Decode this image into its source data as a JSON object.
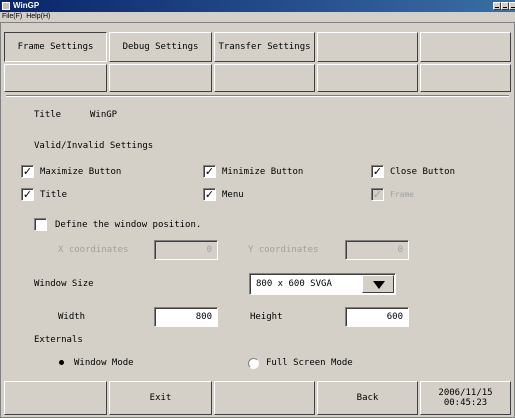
{
  "window": {
    "title": "WinGP"
  },
  "menu": {
    "file": "File(F)",
    "help": "Help(H)"
  },
  "tabs": [
    {
      "label": "Frame Settings",
      "active": true
    },
    {
      "label": "Debug Settings"
    },
    {
      "label": "Transfer Settings"
    },
    {
      "label": ""
    },
    {
      "label": ""
    }
  ],
  "title_row": {
    "label": "Title",
    "value": "WinGP"
  },
  "valid_section": {
    "heading": "Valid/Invalid Settings"
  },
  "checkboxes": {
    "maximize": {
      "label": "Maximize Button",
      "checked": true,
      "mark": "✓"
    },
    "minimize": {
      "label": "Minimize Button",
      "checked": true,
      "mark": "✓"
    },
    "close": {
      "label": "Close Button",
      "checked": true,
      "mark": "✓"
    },
    "title": {
      "label": "Title",
      "checked": true,
      "mark": "✓"
    },
    "menu": {
      "label": "Menu",
      "checked": true,
      "mark": "✓"
    },
    "frame": {
      "label": "Frame",
      "checked": true,
      "disabled": true,
      "mark": "✓"
    },
    "define_position": {
      "label": "Define the window position.",
      "checked": false,
      "mark": ""
    }
  },
  "position": {
    "x_label": "X coordinates",
    "x_value": "0",
    "y_label": "Y coordinates",
    "y_value": "0"
  },
  "window_size": {
    "label": "Window Size",
    "selected": "800 x  600 SVGA"
  },
  "size": {
    "width_label": "Width",
    "width_value": "800",
    "height_label": "Height",
    "height_value": "600"
  },
  "externals": {
    "heading": "Externals",
    "window_mode": "Window Mode",
    "full_screen": "Full Screen Mode",
    "selected": "window_mode"
  },
  "footer": {
    "exit": "Exit",
    "back": "Back",
    "date": "2006/11/15",
    "time": "00:45:23"
  },
  "colors": {
    "face": "#d4d0c8",
    "titlebar": "#0a246a",
    "disabled_text": "#a0a0a0"
  }
}
